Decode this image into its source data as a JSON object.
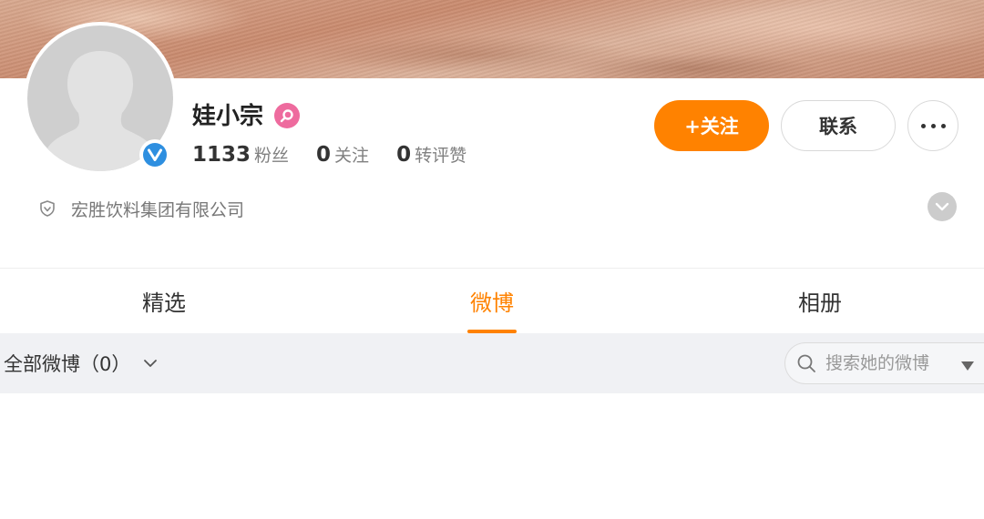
{
  "profile": {
    "name": "娃小宗",
    "stats": [
      {
        "value": "1133",
        "label": "粉丝"
      },
      {
        "value": "0",
        "label": "关注"
      },
      {
        "value": "0",
        "label": "转评赞"
      }
    ],
    "company": "宏胜饮料集团有限公司"
  },
  "actions": {
    "follow_label": "+关注",
    "contact_label": "联系"
  },
  "tabs": [
    {
      "label": "精选",
      "active": false
    },
    {
      "label": "微博",
      "active": true
    },
    {
      "label": "相册",
      "active": false
    }
  ],
  "filter": {
    "label": "全部微博（0）",
    "search_placeholder": "搜索她的微博"
  },
  "colors": {
    "accent": "#ff8200",
    "verified": "#2e8fe0",
    "level_badge": "#ee6b9e"
  }
}
